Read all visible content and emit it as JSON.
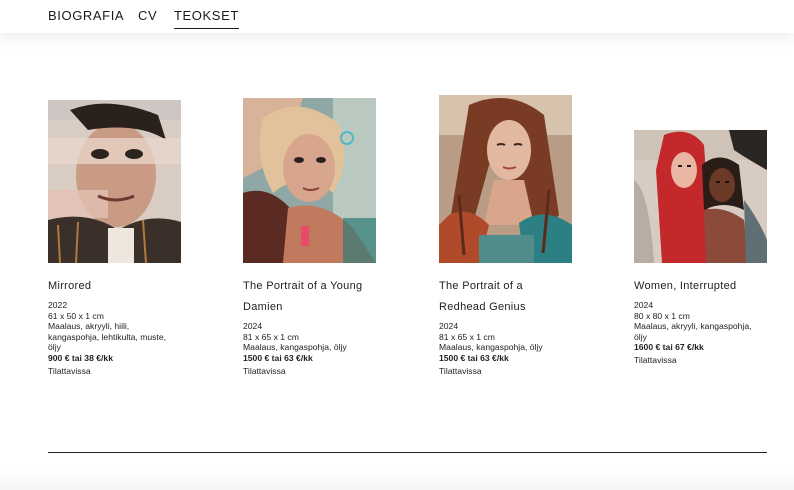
{
  "nav": {
    "items": [
      {
        "label": "BIOGRAFIA"
      },
      {
        "label": "CV"
      },
      {
        "label": "TEOKSET"
      }
    ],
    "active": "TEOKSET"
  },
  "works": [
    {
      "title_lines": [
        "Mirrored"
      ],
      "year": "2022",
      "size": "61 x 50 x 1 cm",
      "medium_lines": [
        "Maalaus, akryyli, hiili,",
        "kangaspohja, lehtikulta, muste,",
        "öljy"
      ],
      "price": "900 € tai 38 €/kk",
      "availability": "Tilattavissa"
    },
    {
      "title_lines": [
        "The Portrait of a Young",
        "Damien"
      ],
      "year": "2024",
      "size": "81 x 65 x 1 cm",
      "medium_lines": [
        "Maalaus, kangaspohja, öljy"
      ],
      "price": "1500 € tai 63 €/kk",
      "availability": "Tilattavissa"
    },
    {
      "title_lines": [
        "The Portrait of a",
        "Redhead Genius"
      ],
      "year": "2024",
      "size": "81 x 65 x 1 cm",
      "medium_lines": [
        "Maalaus, kangaspohja, öljy"
      ],
      "price": "1500 € tai 63 €/kk",
      "availability": "Tilattavissa"
    },
    {
      "title_lines": [
        "Women, Interrupted"
      ],
      "year": "2024",
      "size": "80 x 80 x 1 cm",
      "medium_lines": [
        "Maalaus, akryyli, kangaspohja,",
        "öljy"
      ],
      "price": "1600 € tai 67 €/kk",
      "availability": "Tilattavissa"
    }
  ]
}
